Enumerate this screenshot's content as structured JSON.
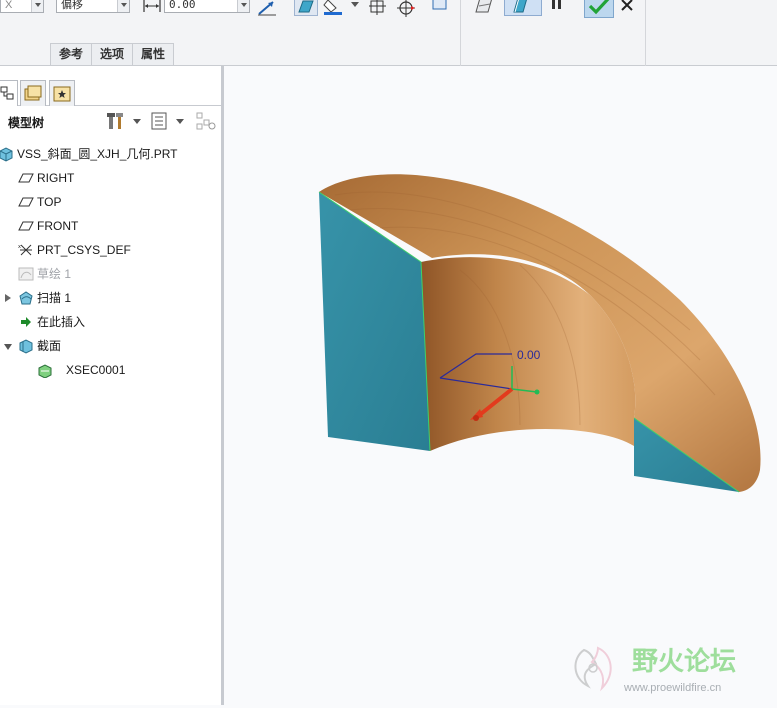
{
  "ribbon": {
    "dropdown_partial": "X",
    "offset_dropdown": "偏移",
    "offset_value": "0.00",
    "tabs": [
      "参考",
      "选项",
      "属性"
    ]
  },
  "model_tree": {
    "title": "模型树",
    "nodes": [
      {
        "label": "VSS_斜面_圆_XJH_几何.PRT",
        "icon": "part-icon"
      },
      {
        "label": "RIGHT",
        "icon": "datum-plane-icon"
      },
      {
        "label": "TOP",
        "icon": "datum-plane-icon"
      },
      {
        "label": "FRONT",
        "icon": "datum-plane-icon"
      },
      {
        "label": "PRT_CSYS_DEF",
        "icon": "csys-icon"
      },
      {
        "label": "草绘 1",
        "icon": "sketch-icon"
      },
      {
        "label": "扫描 1",
        "icon": "sweep-icon"
      },
      {
        "label": "在此插入",
        "icon": "insert-here-icon"
      },
      {
        "label": "截面",
        "icon": "cross-sections-icon"
      },
      {
        "label": "XSEC0001",
        "icon": "xsection-icon"
      }
    ]
  },
  "graphics": {
    "dimension_value": "0.00"
  },
  "watermark": {
    "name": "野火论坛",
    "url": "www.proewildfire.cn"
  },
  "colors": {
    "cut_face": "#31899e",
    "wood_light": "#d49c61",
    "wood_dark": "#a86a36",
    "accent_green": "#21a337"
  }
}
